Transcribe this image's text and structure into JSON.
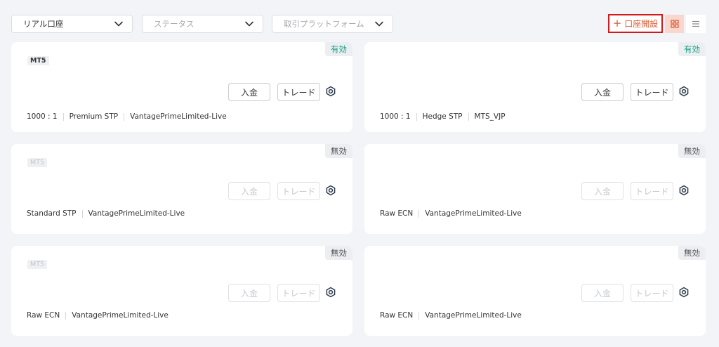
{
  "filters": {
    "account_type": "リアル口座",
    "status_placeholder": "ステータス",
    "platform_placeholder": "取引プラットフォーム"
  },
  "toolbar": {
    "open_account_label": "口座開設",
    "open_account_icon": "plus-icon",
    "grid_view_icon": "grid-icon",
    "list_view_icon": "list-icon",
    "accent_color": "#d85a34",
    "highlight_border_color": "#d11b1b"
  },
  "cards": [
    {
      "status": "有効",
      "platform": "MT5",
      "deposit_label": "入金",
      "trade_label": "トレード",
      "leverage": "1000 : 1",
      "account_type": "Premium STP",
      "server": "VantagePrimeLimited-Live"
    },
    {
      "status": "有効",
      "deposit_label": "入金",
      "trade_label": "トレード",
      "leverage": "1000 : 1",
      "account_type": "Hedge STP",
      "server": "MTS_VJP"
    },
    {
      "status": "無効",
      "platform": "MT5",
      "deposit_label": "入金",
      "trade_label": "トレード",
      "account_type": "Standard STP",
      "server": "VantagePrimeLimited-Live"
    },
    {
      "status": "無効",
      "deposit_label": "入金",
      "trade_label": "トレード",
      "account_type": "Raw ECN",
      "server": "VantagePrimeLimited-Live"
    },
    {
      "status": "無効",
      "platform": "MT5",
      "deposit_label": "入金",
      "trade_label": "トレード",
      "account_type": "Raw ECN",
      "server": "VantagePrimeLimited-Live"
    },
    {
      "status": "無効",
      "deposit_label": "入金",
      "trade_label": "トレード",
      "account_type": "Raw ECN",
      "server": "VantagePrimeLimited-Live"
    }
  ],
  "colors": {
    "status_active": "#19a38a",
    "status_inactive": "#555555"
  }
}
